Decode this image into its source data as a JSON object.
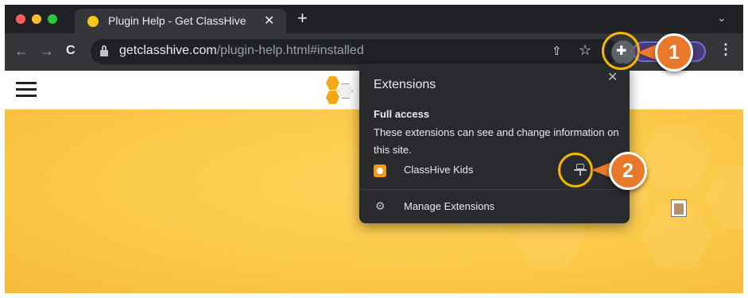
{
  "browser": {
    "tab": {
      "title": "Plugin Help - Get ClassHive",
      "favicon": "bee-favicon-icon",
      "close": "✕"
    },
    "new_tab": "+",
    "tab_menu": "⌄",
    "nav": {
      "back": "←",
      "forward": "→",
      "reload": "C"
    },
    "address": {
      "host": "getclasshive.com",
      "path": "/plugin-help.html#installed"
    },
    "toolbar_icons": {
      "share": "⇧",
      "bookmark": "☆",
      "extensions": "puzzle-icon",
      "menu": "⋮"
    },
    "colors": {
      "tabstrip": "#202124",
      "toolbar": "#35363a",
      "traffic_red": "#ff5f57",
      "traffic_yellow": "#febc2e",
      "traffic_green": "#28c840"
    }
  },
  "extensions_popup": {
    "title": "Extensions",
    "close": "✕",
    "section_heading": "Full access",
    "section_description": "These extensions can see and change information on this site.",
    "items": [
      {
        "name": "ClassHive Kids",
        "icon": "classhive-kids-icon",
        "pin": "pin-icon"
      }
    ],
    "manage_label": "Manage Extensions",
    "manage_icon": "gear-icon"
  },
  "annotations": {
    "callout_1": "1",
    "callout_2": "2",
    "ring_color": "#f7b800",
    "badge_color": "#e8782a"
  },
  "site": {
    "menu": "hamburger-icon",
    "logo": "classhive-logo",
    "hero_color": "#fbc846"
  }
}
